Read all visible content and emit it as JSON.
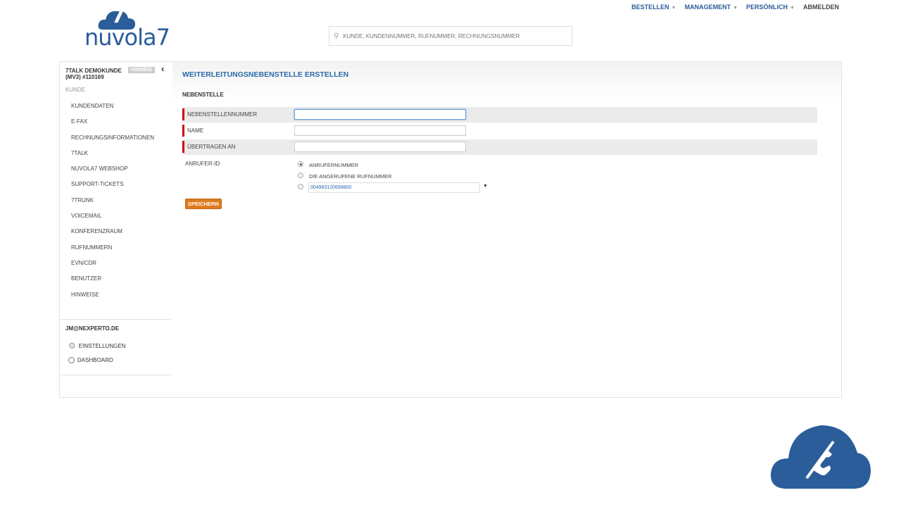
{
  "brand": {
    "name": "nuvola7",
    "mark": "7",
    "color": "#2a5d9a"
  },
  "topnav": {
    "items": [
      {
        "label": "BESTELLEN",
        "dropdown": true
      },
      {
        "label": "MANAGEMENT",
        "dropdown": true
      },
      {
        "label": "PERSÖNLICH",
        "dropdown": true
      },
      {
        "label": "ABMELDEN",
        "dropdown": false
      }
    ]
  },
  "search": {
    "placeholder": "KUNDE, KUNDENNUMMER, RUFNUMMER, RECHNUNGSNUMMER",
    "icon": "search-icon"
  },
  "sidebar": {
    "customer": "7TALK DEMOKUNDE (MV3) #110169",
    "hint_badge": "HINWEIS",
    "section_label": "KUNDE",
    "items": [
      {
        "label": "KUNDENDATEN"
      },
      {
        "label": "E-FAX"
      },
      {
        "label": "RECHNUNGSINFORMATIONEN"
      },
      {
        "label": "7TALK"
      },
      {
        "label": "NUVOLA7 WEBSHOP"
      },
      {
        "label": "SUPPORT-TICKETS"
      },
      {
        "label": "7TRUNK"
      },
      {
        "label": "VOICEMAIL"
      },
      {
        "label": "KONFERENZRAUM"
      },
      {
        "label": "RUFNUMMERN"
      },
      {
        "label": "EVN/CDR"
      },
      {
        "label": "BENUTZER"
      },
      {
        "label": "HINWEISE"
      }
    ],
    "user_email": "JM@NEXPERTO.DE",
    "settings_label": "EINSTELLUNGEN",
    "dashboard_label": "DASHBOARD"
  },
  "main": {
    "title": "WEITERLEITUNGSNEBENSTELLE ERSTELLEN",
    "section": "NEBENSTELLE",
    "fields": [
      {
        "label": "NEBENSTELLENNUMMER",
        "value": "",
        "required": true
      },
      {
        "label": "NAME",
        "value": "",
        "required": true
      },
      {
        "label": "ÜBERTRAGEN AN",
        "value": "",
        "required": true
      }
    ],
    "caller_id": {
      "label": "ANRUFER-ID",
      "options": [
        {
          "label": "ANRUFERNUMMER",
          "selected": true
        },
        {
          "label": "DIE ANGERUFENE RUFNUMMER",
          "selected": false
        }
      ],
      "number_value": "004983120698800"
    },
    "save_label": "SPEICHERN"
  },
  "colors": {
    "accent": "#2a6aab",
    "required": "#cc0000",
    "save": "#e07a1f"
  }
}
